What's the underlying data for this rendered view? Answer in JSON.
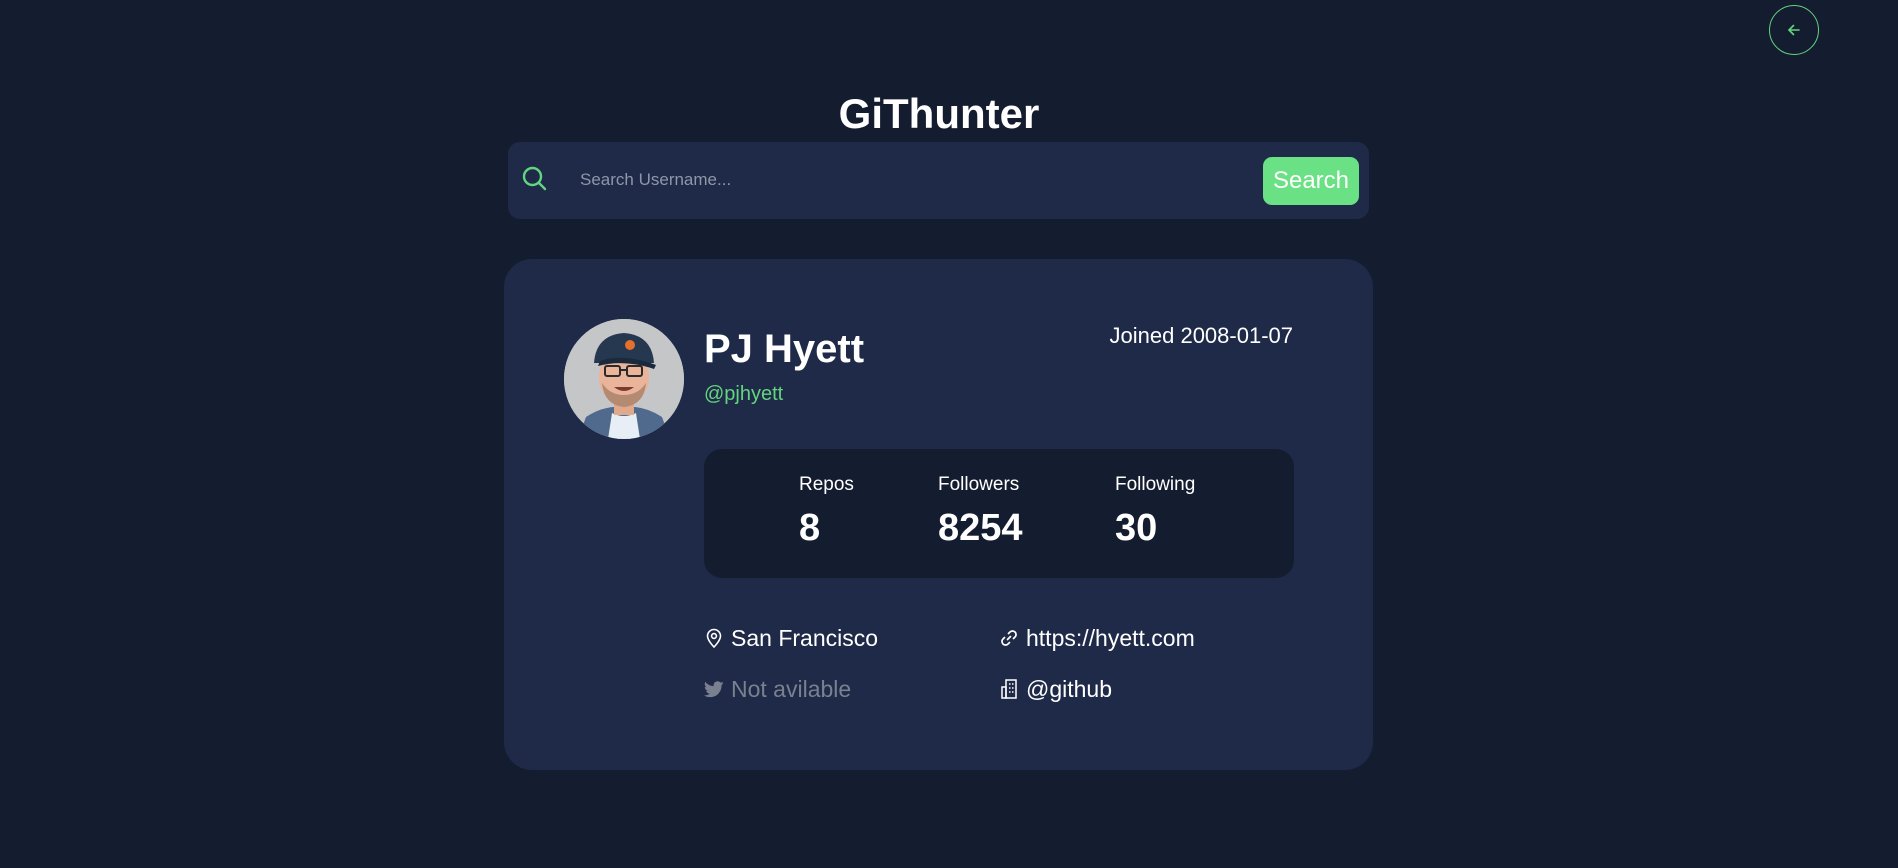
{
  "app": {
    "title": "GiThunter"
  },
  "search": {
    "placeholder": "Search Username...",
    "value": "",
    "button_label": "Search"
  },
  "profile": {
    "name": "PJ Hyett",
    "login": "@pjhyett",
    "joined": "Joined 2008-01-07",
    "stats": {
      "repos_label": "Repos",
      "repos_value": "8",
      "followers_label": "Followers",
      "followers_value": "8254",
      "following_label": "Following",
      "following_value": "30"
    },
    "info": {
      "location": "San Francisco",
      "blog": "https://hyett.com",
      "twitter": "Not avilable",
      "company": "@github"
    }
  },
  "colors": {
    "background": "#141c2f",
    "card": "#1f2a48",
    "accent": "#69e184",
    "muted": "#79808f"
  },
  "icons": {
    "back": "arrow-left-icon",
    "search": "search-icon",
    "location": "map-pin-icon",
    "blog": "link-icon",
    "twitter": "twitter-icon",
    "company": "building-icon"
  }
}
